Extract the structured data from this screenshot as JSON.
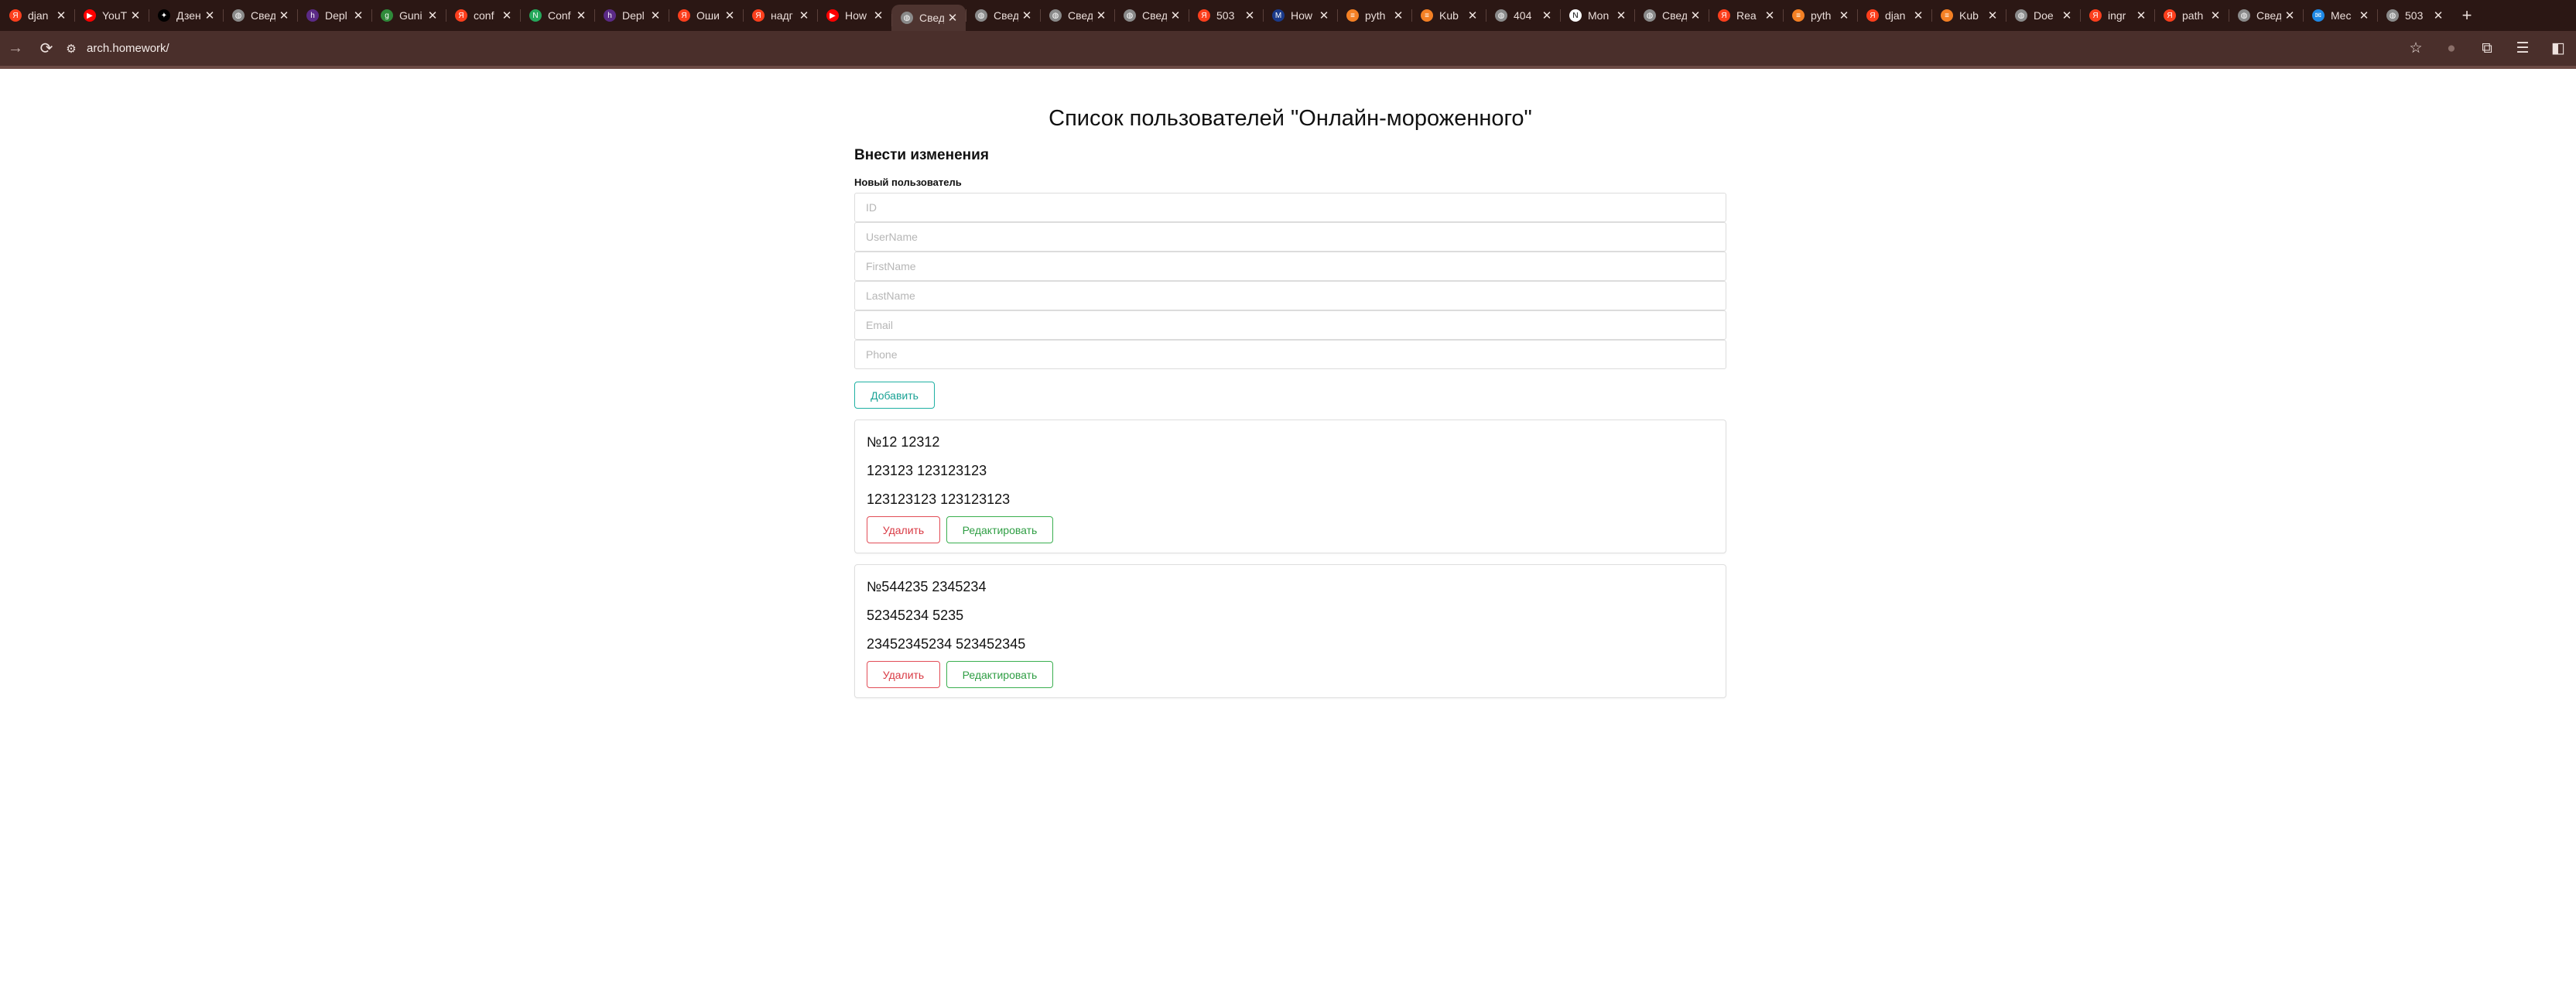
{
  "browser": {
    "tabs": [
      {
        "title": "djan",
        "icon": "yandex-icon",
        "color": "#fc3f1d"
      },
      {
        "title": "YouT",
        "icon": "youtube-icon",
        "color": "#ff0000"
      },
      {
        "title": "Дзен",
        "icon": "dzen-icon",
        "color": "#000000"
      },
      {
        "title": "Свед",
        "icon": "globe-icon",
        "color": "#8a8a8a"
      },
      {
        "title": "Depl",
        "icon": "habr-icon",
        "color": "#5b2a86"
      },
      {
        "title": "Guni",
        "icon": "gunicorn-icon",
        "color": "#2f8a3a"
      },
      {
        "title": "conf",
        "icon": "yandex-icon",
        "color": "#fc3f1d"
      },
      {
        "title": "Conf",
        "icon": "n-icon",
        "color": "#25a85b"
      },
      {
        "title": "Depl",
        "icon": "habr-icon",
        "color": "#5b2a86"
      },
      {
        "title": "Оши",
        "icon": "yandex-icon",
        "color": "#fc3f1d"
      },
      {
        "title": "надг",
        "icon": "yandex-icon",
        "color": "#fc3f1d"
      },
      {
        "title": "How",
        "icon": "youtube-icon",
        "color": "#ff0000"
      },
      {
        "title": "Свед",
        "icon": "globe-icon",
        "color": "#8a8a8a"
      },
      {
        "title": "Свед",
        "icon": "globe-icon",
        "color": "#8a8a8a"
      },
      {
        "title": "Свед",
        "icon": "globe-icon",
        "color": "#8a8a8a"
      },
      {
        "title": "Свед",
        "icon": "globe-icon",
        "color": "#8a8a8a"
      },
      {
        "title": "503",
        "icon": "yandex-icon",
        "color": "#fc3f1d"
      },
      {
        "title": "How",
        "icon": "medium-icon",
        "color": "#1a3a8a"
      },
      {
        "title": "pyth",
        "icon": "stackoverflow-icon",
        "color": "#f48024"
      },
      {
        "title": "Kub",
        "icon": "stackoverflow-icon",
        "color": "#f48024"
      },
      {
        "title": "404",
        "icon": "globe-icon",
        "color": "#8a8a8a"
      },
      {
        "title": "Mon",
        "icon": "notion-icon",
        "color": "#ffffff"
      },
      {
        "title": "Свед",
        "icon": "globe-icon",
        "color": "#8a8a8a"
      },
      {
        "title": "Rea",
        "icon": "yandex-icon",
        "color": "#fc3f1d"
      },
      {
        "title": "pyth",
        "icon": "stackoverflow-icon",
        "color": "#f48024"
      },
      {
        "title": "djan",
        "icon": "yandex-icon",
        "color": "#fc3f1d"
      },
      {
        "title": "Kub",
        "icon": "stackoverflow-icon",
        "color": "#f48024"
      },
      {
        "title": "Doe",
        "icon": "globe-icon",
        "color": "#8a8a8a"
      },
      {
        "title": "ingr",
        "icon": "yandex-icon",
        "color": "#fc3f1d"
      },
      {
        "title": "path",
        "icon": "yandex-icon",
        "color": "#fc3f1d"
      },
      {
        "title": "Свед",
        "icon": "globe-icon",
        "color": "#8a8a8a"
      },
      {
        "title": "Mec",
        "icon": "messenger-icon",
        "color": "#1e88e5"
      },
      {
        "title": "503",
        "icon": "globe-icon",
        "color": "#8a8a8a"
      }
    ],
    "active_tab_index": 12,
    "url": "arch.homework/"
  },
  "page": {
    "title": "Список пользователей \"Онлайн-мороженного\"",
    "section_title": "Внести изменения",
    "new_user_label": "Новый пользователь",
    "placeholders": {
      "id": "ID",
      "username": "UserName",
      "firstname": "FirstName",
      "lastname": "LastName",
      "email": "Email",
      "phone": "Phone"
    },
    "add_button": "Добавить",
    "delete_button": "Удалить",
    "edit_button": "Редактировать",
    "users": [
      {
        "line1": "№12 12312",
        "line2": "123123 123123123",
        "line3": "123123123 123123123"
      },
      {
        "line1": "№544235 2345234",
        "line2": "52345234 5235",
        "line3": "23452345234 523452345"
      }
    ]
  }
}
